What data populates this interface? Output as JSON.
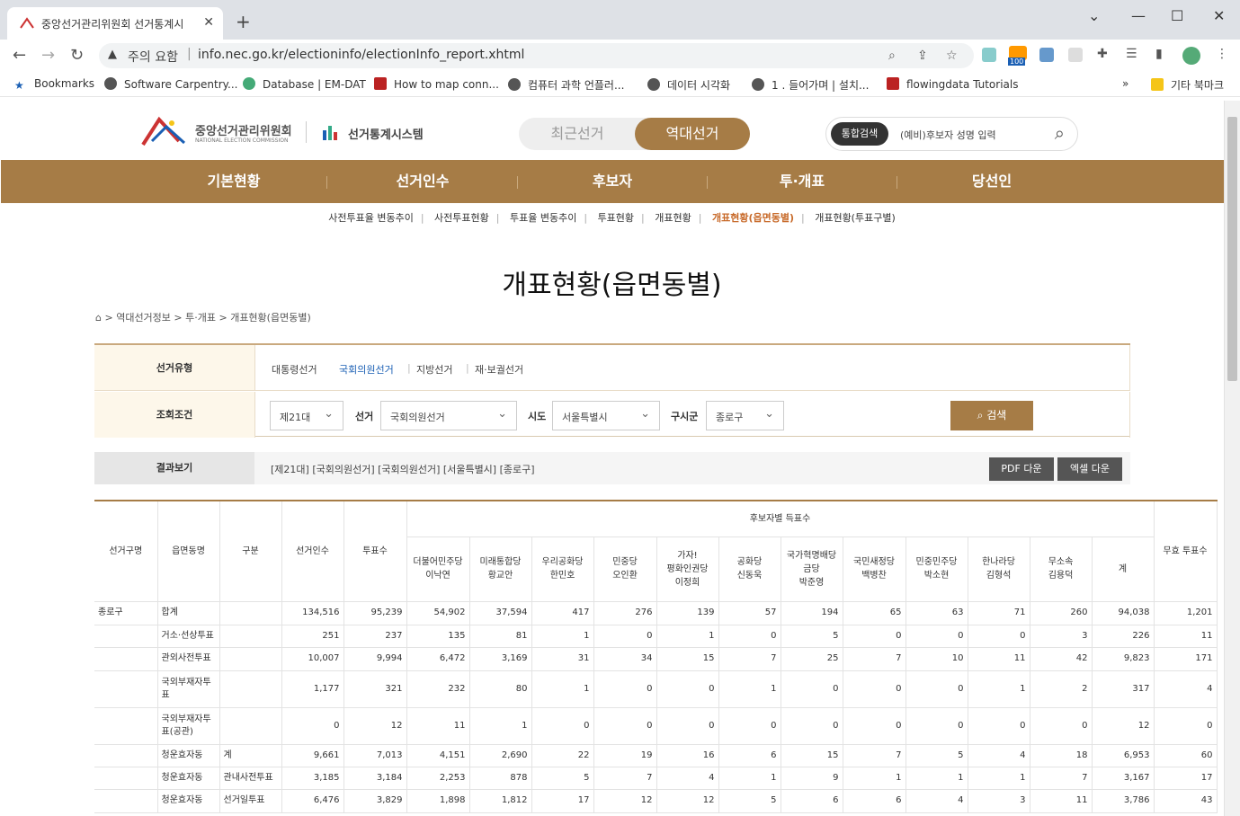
{
  "browser": {
    "tab_title": "중앙선거관리위원회 선거통계시",
    "security_label": "주의 요함",
    "url": "info.nec.go.kr/electioninfo/electionInfo_report.xhtml",
    "ext_badge": "100",
    "bookmarks": [
      "Bookmarks",
      "Software Carpentry...",
      "Database | EM-DAT",
      "How to map conn...",
      "컴퓨터 과학 언플러...",
      "데이터 시각화",
      "1 . 들어가며 | 설치...",
      "flowingdata Tutorials"
    ],
    "other_bookmarks": "기타 북마크"
  },
  "header": {
    "org": "중앙선거관리위원회",
    "org_en": "NATIONAL ELECTION COMMISSION",
    "system": "선거통계시스템",
    "toggle_recent": "최근선거",
    "toggle_past": "역대선거",
    "search_pill": "통합검색",
    "search_placeholder": "(예비)후보자 성명 입력"
  },
  "nav": [
    "기본현황",
    "선거인수",
    "후보자",
    "투·개표",
    "당선인"
  ],
  "subnav": [
    "사전투표율 변동추이",
    "사전투표현황",
    "투표율 변동추이",
    "투표현황",
    "개표현황",
    "개표현황(읍면동별)",
    "개표현황(투표구별)"
  ],
  "page_title": "개표현황(읍면동별)",
  "breadcrumb": "> 역대선거정보 > 투·개표 > 개표현황(읍면동별)",
  "filter": {
    "type_label": "선거유형",
    "types": [
      "대통령선거",
      "국회의원선거",
      "지방선거",
      "재·보궐선거"
    ],
    "cond_label": "조회조건",
    "session": "제21대",
    "election_label": "선거",
    "election": "국회의원선거",
    "sido_label": "시도",
    "sido": "서울특별시",
    "gusigun_label": "구시군",
    "gusigun": "종로구",
    "search_btn": "검색"
  },
  "result": {
    "label": "결과보기",
    "text": "[제21대] [국회의원선거] [국회의원선거] [서울특별시] [종로구]",
    "pdf": "PDF 다운",
    "excel": "엑셀 다운"
  },
  "table": {
    "h_district": "선거구명",
    "h_dong": "읍면동명",
    "h_type": "구분",
    "h_voters": "선거인수",
    "h_votes": "투표수",
    "h_group": "후보자별 득표수",
    "candidates": [
      [
        "더불어민주당",
        "이낙연"
      ],
      [
        "미래통합당",
        "황교안"
      ],
      [
        "우리공화당",
        "한민호"
      ],
      [
        "민중당",
        "오인환"
      ],
      [
        "가자!",
        "평화인권당",
        "이정희"
      ],
      [
        "공화당",
        "신동욱"
      ],
      [
        "국가혁명배당",
        "금당",
        "박준영"
      ],
      [
        "국민새정당",
        "백병찬"
      ],
      [
        "민중민주당",
        "박소현"
      ],
      [
        "한나라당",
        "김형석"
      ],
      [
        "무소속",
        "김용덕"
      ]
    ],
    "h_total": "계",
    "h_invalid": "무효 투표수",
    "rows": [
      [
        "종로구",
        "합계",
        "",
        "134,516",
        "95,239",
        "54,902",
        "37,594",
        "417",
        "276",
        "139",
        "57",
        "194",
        "65",
        "63",
        "71",
        "260",
        "94,038",
        "1,201"
      ],
      [
        "",
        "거소·선상투표",
        "",
        "251",
        "237",
        "135",
        "81",
        "1",
        "0",
        "1",
        "0",
        "5",
        "0",
        "0",
        "0",
        "3",
        "226",
        "11"
      ],
      [
        "",
        "관외사전투표",
        "",
        "10,007",
        "9,994",
        "6,472",
        "3,169",
        "31",
        "34",
        "15",
        "7",
        "25",
        "7",
        "10",
        "11",
        "42",
        "9,823",
        "171"
      ],
      [
        "",
        "국외부재자투표",
        "",
        "1,177",
        "321",
        "232",
        "80",
        "1",
        "0",
        "0",
        "1",
        "0",
        "0",
        "0",
        "1",
        "2",
        "317",
        "4"
      ],
      [
        "",
        "국외부재자투표(공관)",
        "",
        "0",
        "12",
        "11",
        "1",
        "0",
        "0",
        "0",
        "0",
        "0",
        "0",
        "0",
        "0",
        "0",
        "12",
        "0"
      ],
      [
        "",
        "청운효자동",
        "계",
        "9,661",
        "7,013",
        "4,151",
        "2,690",
        "22",
        "19",
        "16",
        "6",
        "15",
        "7",
        "5",
        "4",
        "18",
        "6,953",
        "60"
      ],
      [
        "",
        "청운효자동",
        "관내사전투표",
        "3,185",
        "3,184",
        "2,253",
        "878",
        "5",
        "7",
        "4",
        "1",
        "9",
        "1",
        "1",
        "1",
        "7",
        "3,167",
        "17"
      ],
      [
        "",
        "청운효자동",
        "선거일투표",
        "6,476",
        "3,829",
        "1,898",
        "1,812",
        "17",
        "12",
        "12",
        "5",
        "6",
        "6",
        "4",
        "3",
        "11",
        "3,786",
        "43"
      ]
    ]
  },
  "colors": {
    "brand": "#a67c46",
    "active": "#c86a2a",
    "link": "#1a5fb4"
  }
}
